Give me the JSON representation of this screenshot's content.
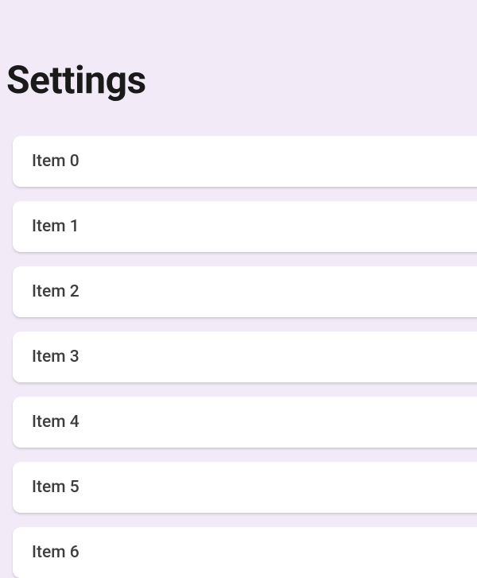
{
  "title": "Settings",
  "items": [
    {
      "label": "Item 0"
    },
    {
      "label": "Item 1"
    },
    {
      "label": "Item 2"
    },
    {
      "label": "Item 3"
    },
    {
      "label": "Item 4"
    },
    {
      "label": "Item 5"
    },
    {
      "label": "Item 6"
    }
  ]
}
